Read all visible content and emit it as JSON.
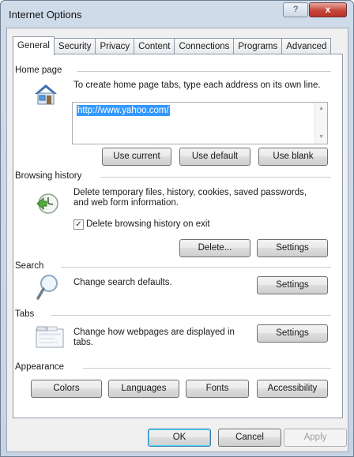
{
  "window": {
    "title": "Internet Options",
    "help_label": "?",
    "close_label": "x"
  },
  "tabs": [
    {
      "label": "General",
      "active": true
    },
    {
      "label": "Security"
    },
    {
      "label": "Privacy"
    },
    {
      "label": "Content"
    },
    {
      "label": "Connections"
    },
    {
      "label": "Programs"
    },
    {
      "label": "Advanced"
    }
  ],
  "home_page": {
    "heading": "Home page",
    "description": "To create home page tabs, type each address on its own line.",
    "url": "http://www.yahoo.com/",
    "use_current": "Use current",
    "use_default": "Use default",
    "use_blank": "Use blank"
  },
  "browsing_history": {
    "heading": "Browsing history",
    "description_line1": "Delete temporary files, history, cookies, saved passwords,",
    "description_line2": "and web form information.",
    "checkbox_label": "Delete browsing history on exit",
    "checkbox_checked": true,
    "checkbox_mark": "✓",
    "delete_button": "Delete...",
    "settings_button": "Settings"
  },
  "search": {
    "heading": "Search",
    "description": "Change search defaults.",
    "settings_button": "Settings"
  },
  "tabs_section": {
    "heading": "Tabs",
    "description_line1": "Change how webpages are displayed in",
    "description_line2": "tabs.",
    "settings_button": "Settings"
  },
  "appearance": {
    "heading": "Appearance",
    "colors": "Colors",
    "languages": "Languages",
    "fonts": "Fonts",
    "accessibility": "Accessibility"
  },
  "footer": {
    "ok": "OK",
    "cancel": "Cancel",
    "apply": "Apply",
    "apply_enabled": false
  },
  "icons": {
    "home": "home-icon",
    "history": "clock-arrow-icon",
    "search": "magnifier-icon",
    "tabs": "tabs-window-icon",
    "scroll_up": "▲",
    "scroll_down": "▼"
  },
  "colors": {
    "title_bar": "#cfdbe9",
    "close_button": "#c7453a",
    "selection": "#3399ff"
  }
}
